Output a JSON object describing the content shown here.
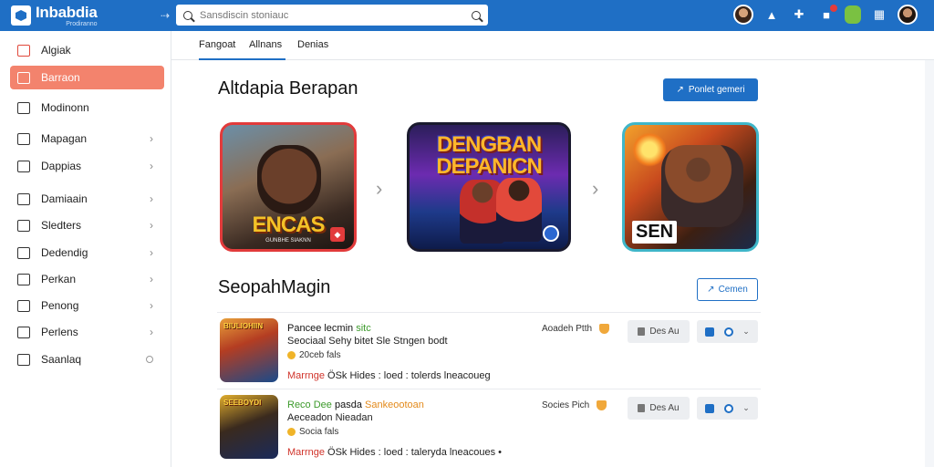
{
  "header": {
    "logo_name": "Inbabdia",
    "logo_sub": "Prodiranno",
    "collapse_glyph": "⇢",
    "search_placeholder": "Sansdiscin stoniauc",
    "icons": [
      "search-icon",
      "user-avatar",
      "upload-icon",
      "puzzle-icon",
      "notifications-icon",
      "app-icon",
      "grid-icon",
      "profile-avatar"
    ],
    "colors": {
      "bar": "#1f6fc5",
      "notification_dot": "#e23b3b"
    }
  },
  "sidebar": {
    "items": [
      {
        "label": "Algiak",
        "icon": "store-icon",
        "chevron": false
      },
      {
        "label": "Barraon",
        "icon": "calendar-icon",
        "chevron": false,
        "active": true
      },
      {
        "label": "Modinonn",
        "icon": "edit-icon",
        "chevron": false
      },
      {
        "label": "Mapagan",
        "icon": "pencil-icon",
        "chevron": true
      },
      {
        "label": "Dappias",
        "icon": "folder-icon",
        "chevron": true
      },
      {
        "label": "Damiaain",
        "icon": "message-icon",
        "chevron": true
      },
      {
        "label": "Sledters",
        "icon": "home-icon",
        "chevron": true
      },
      {
        "label": "Dedendig",
        "icon": "document-icon",
        "chevron": true
      },
      {
        "label": "Perkan",
        "icon": "card-icon",
        "chevron": true
      },
      {
        "label": "Penong",
        "icon": "pen-icon",
        "chevron": true
      },
      {
        "label": "Perlens",
        "icon": "clock-icon",
        "chevron": true
      },
      {
        "label": "Saanlaq",
        "icon": "inbox-icon",
        "chevron": false,
        "circle": true
      }
    ],
    "colors": {
      "active": "#f3836d"
    }
  },
  "tabs": [
    {
      "label": "Fangoat"
    },
    {
      "label": "Allnans",
      "active": true
    },
    {
      "label": "Denias"
    }
  ],
  "featured": {
    "title": "Altdapia Berapan",
    "action_label": "Ponlet gemeri",
    "action_glyph": "↗",
    "cards": [
      {
        "caption": "ENCAS",
        "sub": "GUNBHE SIAKNN"
      },
      {
        "caption": "DENGBAN DEPANICN"
      },
      {
        "caption": "SEN",
        "sign": "sen"
      }
    ]
  },
  "list": {
    "title": "SeopahMagin",
    "action_label": "Cemen",
    "action_glyph": "↗",
    "rows": [
      {
        "thumb_label": "BIULIOHIIN",
        "title": "Pancee lecmin",
        "title_hl": "sitc",
        "desc": "Seociaal Sehy bitet Sle Stngen bodt",
        "meta": "20ceb fals",
        "foot_red": "Marrnge",
        "foot": "ÖSk Hides : loed : tolerds lneacoueg",
        "right_label": "Aoadeh Ptth",
        "grey_label": "Des Au"
      },
      {
        "thumb_label": "SEEBOYDI",
        "title": "Reco Dee",
        "title_hl": "pasda",
        "title_hl2": "Sankeootoan",
        "desc": "Aeceadon Nieadan",
        "meta": "Socia fals",
        "foot_red": "Marrnge",
        "foot": "ÖSk Hides : loed : taleryda lneacoues •",
        "right_label": "Socies Pich",
        "grey_label": "Des Au"
      }
    ]
  }
}
